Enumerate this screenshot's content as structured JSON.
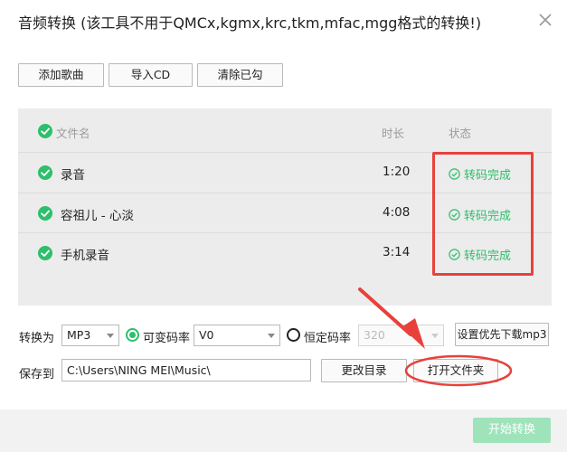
{
  "dialog": {
    "title": "音频转换 (该工具不用于QMCx,kgmx,krc,tkm,mfac,mgg格式的转换!)",
    "close_icon": "close-icon"
  },
  "toolbar": {
    "add_song": "添加歌曲",
    "import_cd": "导入CD",
    "clear_checked": "清除已勾"
  },
  "table": {
    "headers": {
      "filename": "文件名",
      "duration": "时长",
      "status": "状态"
    },
    "rows": [
      {
        "name": "录音",
        "duration": "1:20",
        "status": "转码完成"
      },
      {
        "name": "容祖儿 - 心淡",
        "duration": "4:08",
        "status": "转码完成"
      },
      {
        "name": "手机录音",
        "duration": "3:14",
        "status": "转码完成"
      }
    ]
  },
  "settings": {
    "convert_to_label": "转换为",
    "format_value": "MP3",
    "vbr_label": "可变码率",
    "vbr_value": "V0",
    "cbr_label": "恒定码率",
    "cbr_value": "320",
    "prefer_mp3_button": "设置优先下载mp3",
    "save_to_label": "保存到",
    "save_path": "C:\\Users\\NING MEI\\Music\\",
    "change_dir_button": "更改目录",
    "open_folder_button": "打开文件夹"
  },
  "footer": {
    "start_button": "开始转换"
  },
  "colors": {
    "accent_green": "#2dbf6b",
    "annotation_red": "#e8413b"
  }
}
